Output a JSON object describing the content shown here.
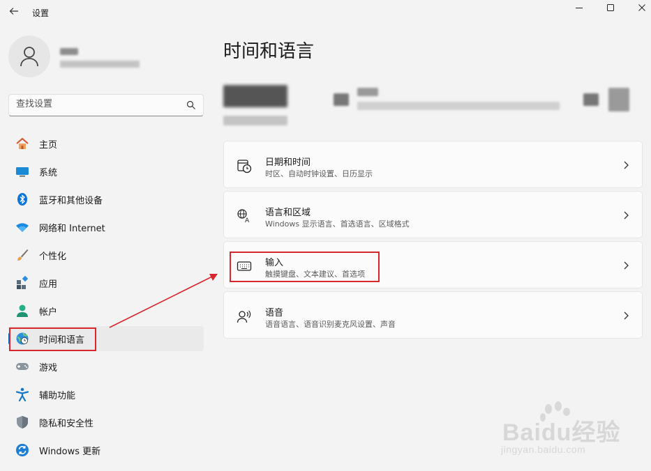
{
  "window": {
    "title": "设置"
  },
  "sidebar": {
    "search_placeholder": "查找设置",
    "items": [
      {
        "label": "主页",
        "icon": "home-icon"
      },
      {
        "label": "系统",
        "icon": "system-icon"
      },
      {
        "label": "蓝牙和其他设备",
        "icon": "bluetooth-icon"
      },
      {
        "label": "网络和 Internet",
        "icon": "wifi-icon"
      },
      {
        "label": "个性化",
        "icon": "brush-icon"
      },
      {
        "label": "应用",
        "icon": "apps-icon"
      },
      {
        "label": "帐户",
        "icon": "account-icon"
      },
      {
        "label": "时间和语言",
        "icon": "globe-clock-icon",
        "selected": true
      },
      {
        "label": "游戏",
        "icon": "gamepad-icon"
      },
      {
        "label": "辅助功能",
        "icon": "accessibility-icon"
      },
      {
        "label": "隐私和安全性",
        "icon": "shield-icon"
      },
      {
        "label": "Windows 更新",
        "icon": "update-icon"
      }
    ]
  },
  "main": {
    "title": "时间和语言",
    "cards": [
      {
        "title": "日期和时间",
        "subtitle": "时区、自动时钟设置、日历显示",
        "icon": "calendar-clock-icon"
      },
      {
        "title": "语言和区域",
        "subtitle": "Windows 显示语言、首选语言、区域格式",
        "icon": "language-icon"
      },
      {
        "title": "输入",
        "subtitle": "触摸键盘、文本建议、首选项",
        "icon": "keyboard-icon"
      },
      {
        "title": "语音",
        "subtitle": "语音语言、语音识别麦克风设置、声音",
        "icon": "speech-icon"
      }
    ]
  },
  "watermark": {
    "brand": "Baidu经验",
    "url": "jingyan.baidu.com"
  },
  "colors": {
    "accent": "#0067c0",
    "annotation_red": "#d9262c",
    "background": "#f3f3f3",
    "card": "#fbfbfb"
  }
}
